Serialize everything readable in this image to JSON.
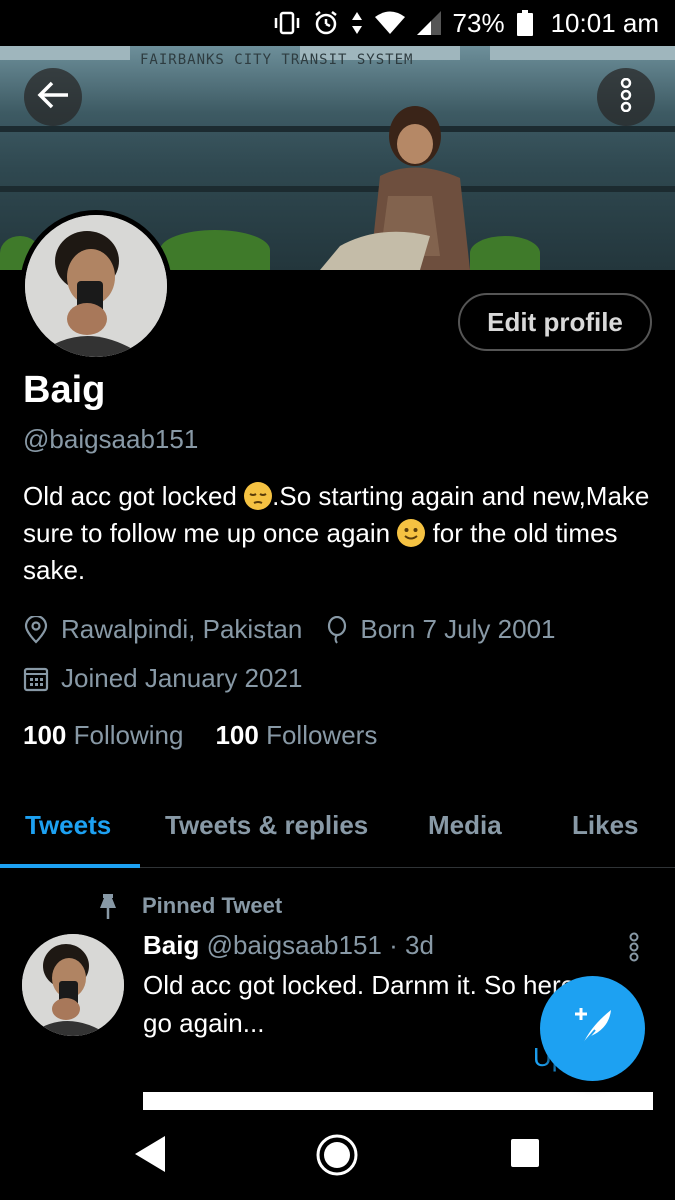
{
  "status_bar": {
    "battery": "73%",
    "time": "10:01 am"
  },
  "banner": {
    "sign_text": "FAIRBANKS CITY TRANSIT SYSTEM"
  },
  "profile": {
    "edit_label": "Edit profile",
    "name": "Baig",
    "handle": "@baigsaab151",
    "bio_part1": "Old acc got locked ",
    "bio_part2": ".So starting again and new,Make sure to follow me up once again ",
    "bio_part3": " for the old times sake.",
    "location": "Rawalpindi, Pakistan",
    "birthday": "Born 7 July 2001",
    "joined": "Joined January 2021",
    "following_count": "100",
    "following_label": "Following",
    "followers_count": "100",
    "followers_label": "Followers"
  },
  "tabs": [
    {
      "label": "Tweets"
    },
    {
      "label": "Tweets & replies"
    },
    {
      "label": "Media"
    },
    {
      "label": "Likes"
    }
  ],
  "pinned_tweet": {
    "pinned_label": "Pinned Tweet",
    "author": "Baig",
    "handle": "@baigsaab151",
    "separator": "·",
    "age": "3d",
    "text": "Old acc got locked. Darnm it. So here we go again...",
    "link_fragment": "Up"
  },
  "colors": {
    "accent": "#1da1f2",
    "secondary_text": "#8899a6",
    "background": "#000000"
  },
  "icons": [
    "vibrate-icon",
    "alarm-icon",
    "data-arrows-icon",
    "wifi-icon",
    "signal-icon",
    "battery-icon",
    "back-arrow-icon",
    "more-vertical-icon",
    "location-pin-icon",
    "balloon-icon",
    "calendar-icon",
    "pin-icon",
    "compose-tweet-icon",
    "nav-back-icon",
    "nav-home-icon",
    "nav-recents-icon"
  ]
}
